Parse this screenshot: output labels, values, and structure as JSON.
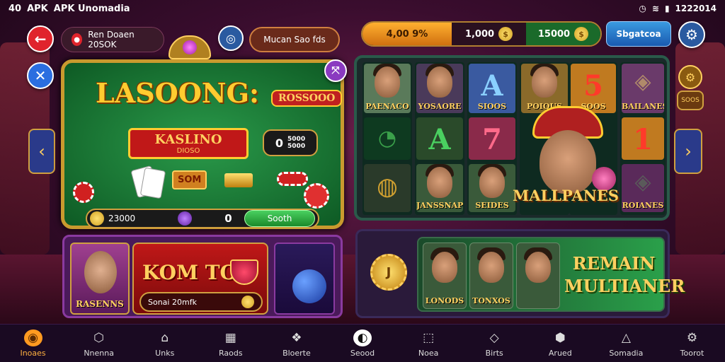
{
  "status": {
    "left_code": "40",
    "app": "APK",
    "app_title": "APK Unomadia",
    "time": "1222014"
  },
  "top": {
    "player_label": "Ren Doaen 20SOK",
    "mid_label": "Mucan Sao fds",
    "currency": [
      {
        "value": "4,00 9%"
      },
      {
        "value": "1,000"
      },
      {
        "value": "15000"
      }
    ],
    "sign_label": "Sbgatcoa"
  },
  "game": {
    "title": "LASOONG:",
    "tag": "ROSSOOO",
    "banner_main": "KASLINO",
    "banner_sub": "DIOSO",
    "odds_zero": "0",
    "odds_line1": "5000",
    "odds_line2": "5000",
    "som": "SOM",
    "footer_amount": "23000",
    "footer_zero": "0",
    "footer_btn": "Sooth"
  },
  "slots": {
    "reels": [
      {
        "cells": [
          {
            "label": "PAENACO",
            "kind": "face"
          },
          {
            "label": "",
            "kind": "swirl"
          },
          {
            "label": "",
            "kind": "medal"
          }
        ]
      },
      {
        "cells": [
          {
            "label": "YOSAORE",
            "kind": "face"
          },
          {
            "big": "A",
            "label": "",
            "kind": "letter"
          },
          {
            "label": "JANSSNAP",
            "kind": "face"
          }
        ]
      },
      {
        "cells": [
          {
            "big": "A",
            "label": "SIOOS",
            "kind": "letter"
          },
          {
            "big": "7",
            "label": "",
            "kind": "letter"
          },
          {
            "label": "SEIDES",
            "kind": "face"
          }
        ]
      },
      {
        "cells": [
          {
            "label": "POIOUS",
            "kind": "face"
          },
          {
            "big": "5",
            "label": "SOOS",
            "kind": "letter"
          }
        ]
      },
      {
        "cells": [
          {
            "label": "BAILANES",
            "kind": "cat"
          },
          {
            "big": "1",
            "label": "",
            "kind": "letter"
          },
          {
            "label": "ROIANES",
            "kind": "cat"
          }
        ]
      }
    ],
    "center_label": "MALLPANES",
    "side_tag": "SOOS"
  },
  "promo_left": {
    "portrait_label": "RASENNS",
    "title": "KOM TO",
    "sub_label": "Sonai 20mfk"
  },
  "promo_right": {
    "icon_letter": "J",
    "chars": [
      {
        "label": "LONODS"
      },
      {
        "label": "TONXOS"
      },
      {
        "label": ""
      }
    ],
    "text_line1": "REMAIN",
    "text_line2": "MULTIANER"
  },
  "nav": [
    {
      "label": "Inoaes",
      "icon": "home-icon",
      "glyph": "◉"
    },
    {
      "label": "Nnenna",
      "icon": "cube-icon",
      "glyph": "⬡"
    },
    {
      "label": "Unks",
      "icon": "shield-icon",
      "glyph": "⌂"
    },
    {
      "label": "Raods",
      "icon": "grid-icon",
      "glyph": "▦"
    },
    {
      "label": "Bloerte",
      "icon": "gem-icon",
      "glyph": "❖"
    },
    {
      "label": "Seood",
      "icon": "spin-icon",
      "glyph": "◐"
    },
    {
      "label": "Noea",
      "icon": "box-icon",
      "glyph": "⬚"
    },
    {
      "label": "Birts",
      "icon": "diamond-icon",
      "glyph": "◇"
    },
    {
      "label": "Arued",
      "icon": "badge-icon",
      "glyph": "⬢"
    },
    {
      "label": "Somadia",
      "icon": "triangle-icon",
      "glyph": "△"
    },
    {
      "label": "Toorot",
      "icon": "gear-icon",
      "glyph": "⚙"
    }
  ]
}
